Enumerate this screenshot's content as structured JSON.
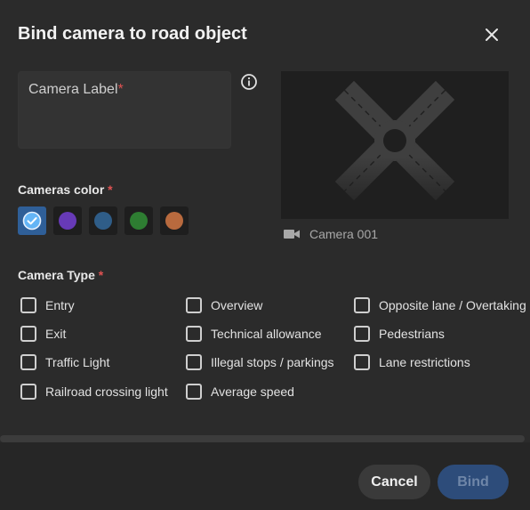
{
  "dialog": {
    "title": "Bind camera to road object"
  },
  "camera_label": {
    "label": "Camera Label",
    "required_mark": "*",
    "value": ""
  },
  "preview": {
    "camera_name": "Camera 001"
  },
  "colors": {
    "label": "Cameras color",
    "required_mark": "*",
    "options": [
      {
        "color": "#64b5f6",
        "selected": true
      },
      {
        "color": "#673ab7",
        "selected": false
      },
      {
        "color": "#2f5d88",
        "selected": false
      },
      {
        "color": "#2e7d32",
        "selected": false
      },
      {
        "color": "#b86a3e",
        "selected": false
      }
    ]
  },
  "camera_type": {
    "label": "Camera Type",
    "required_mark": "*",
    "options": [
      "Entry",
      "Exit",
      "Traffic Light",
      "Railroad crossing light",
      "Overview",
      "Technical allowance",
      "Illegal stops / parkings",
      "Average speed",
      "Opposite lane / Overtaking",
      "Pedestrians",
      "Lane restrictions"
    ]
  },
  "footer": {
    "cancel_label": "Cancel",
    "bind_label": "Bind"
  }
}
